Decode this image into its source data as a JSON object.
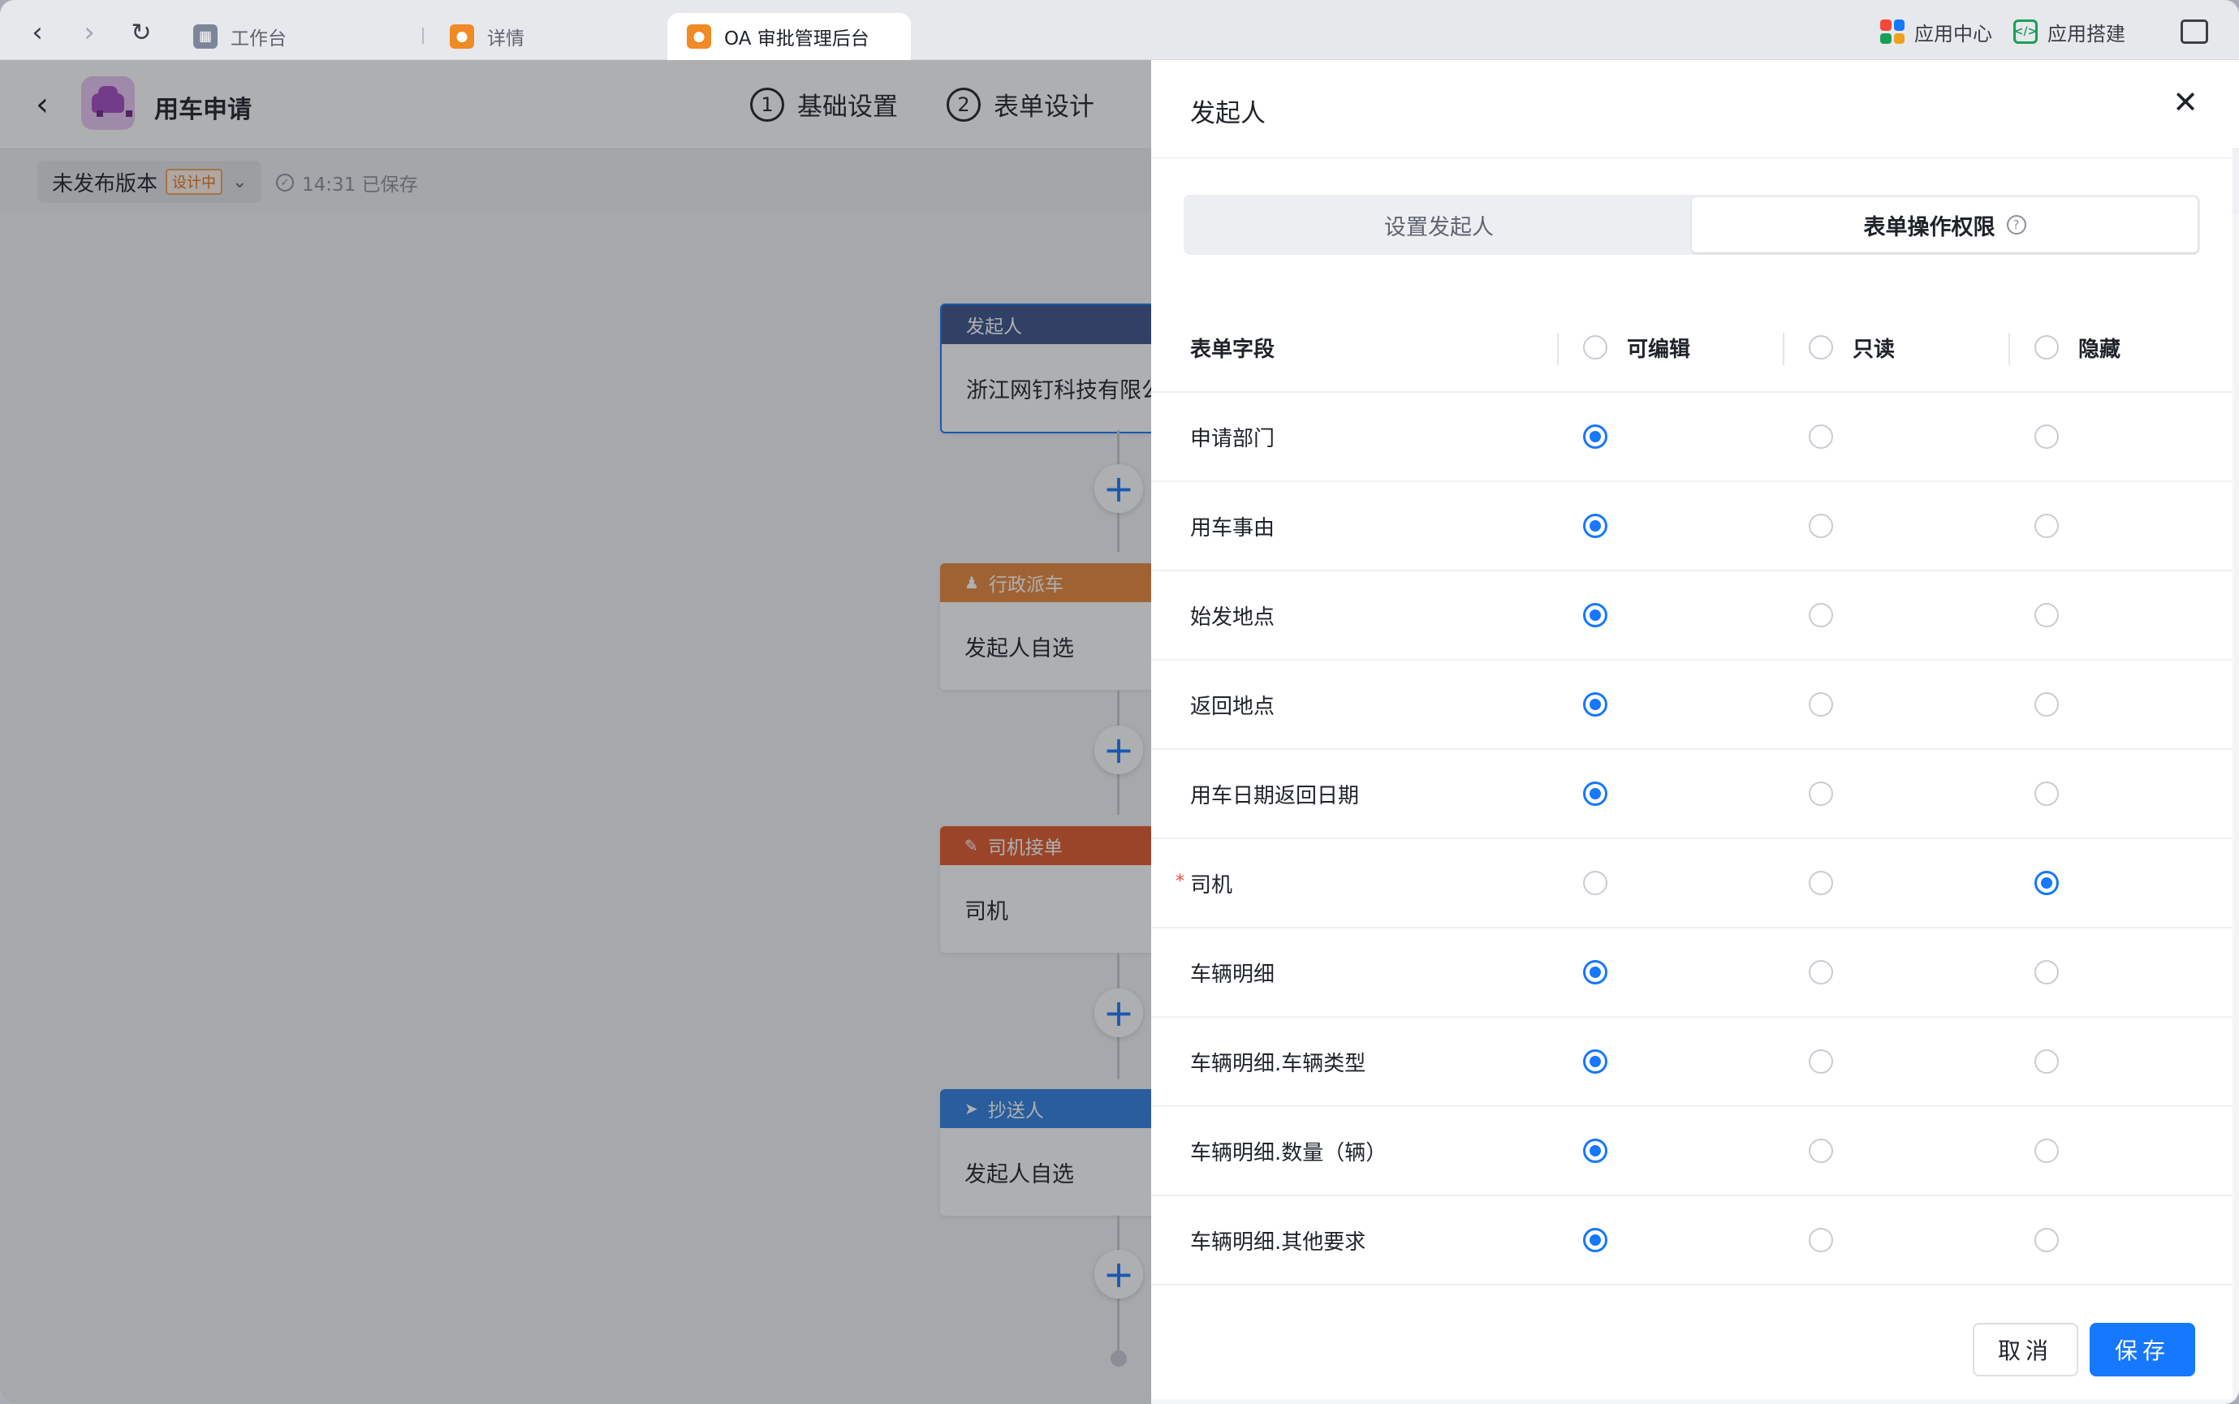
{
  "browser": {
    "tabs": [
      {
        "label": "工作台",
        "icon": "org-chart-icon",
        "color": "#7d8699"
      },
      {
        "label": "详情",
        "icon": "person-icon",
        "color": "#f08a24"
      },
      {
        "label": "OA 审批管理后台",
        "icon": "person-icon",
        "color": "#f08a24"
      }
    ],
    "app_center_label": "应用中心",
    "app_builder_label": "应用搭建"
  },
  "designer": {
    "title": "用车申请",
    "steps": [
      {
        "num": "1",
        "label": "基础设置"
      },
      {
        "num": "2",
        "label": "表单设计"
      }
    ],
    "version_label": "未发布版本",
    "version_badge": "设计中",
    "saved_text": "14:31 已保存"
  },
  "flow": {
    "nodes": [
      {
        "title": "发起人",
        "body": "浙江网钉科技有限公司",
        "color": "#3a5488",
        "icon": ""
      },
      {
        "title": "行政派车",
        "body": "发起人自选",
        "color": "#e8893a",
        "icon": "person-icon"
      },
      {
        "title": "司机接单",
        "body": "司机",
        "color": "#e05a2b",
        "icon": "edit-icon"
      },
      {
        "title": "抄送人",
        "body": "发起人自选",
        "color": "#2f7fe0",
        "icon": "send-icon"
      }
    ]
  },
  "drawer": {
    "title": "发起人",
    "tabs": [
      {
        "label": "设置发起人",
        "active": false
      },
      {
        "label": "表单操作权限",
        "active": true
      }
    ],
    "table": {
      "field_header": "表单字段",
      "columns": [
        "可编辑",
        "只读",
        "隐藏"
      ],
      "rows": [
        {
          "field": "申请部门",
          "value": 0,
          "required": false
        },
        {
          "field": "用车事由",
          "value": 0,
          "required": false
        },
        {
          "field": "始发地点",
          "value": 0,
          "required": false
        },
        {
          "field": "返回地点",
          "value": 0,
          "required": false
        },
        {
          "field": "用车日期返回日期",
          "value": 0,
          "required": false
        },
        {
          "field": "司机",
          "value": 2,
          "required": true
        },
        {
          "field": "车辆明细",
          "value": 0,
          "required": false
        },
        {
          "field": "车辆明细.车辆类型",
          "value": 0,
          "required": false
        },
        {
          "field": "车辆明细.数量（辆）",
          "value": 0,
          "required": false
        },
        {
          "field": "车辆明细.其他要求",
          "value": 0,
          "required": false
        }
      ]
    },
    "cancel_label": "取消",
    "save_label": "保存"
  },
  "colors": {
    "primary": "#1677ff",
    "required": "#f5483b"
  }
}
